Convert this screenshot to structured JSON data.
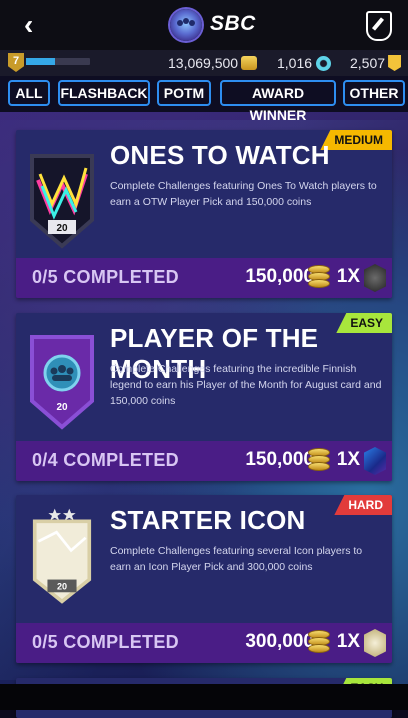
{
  "header": {
    "title": "SBC",
    "back_icon": "back-arrow-icon",
    "tool_icon": "hammer-shield-icon"
  },
  "status": {
    "level": "7",
    "xp_progress": 0.45,
    "coins": "13,069,500",
    "points": "1,016",
    "tokens": "2,507"
  },
  "tabs": [
    "ALL",
    "FLASHBACK",
    "POTM",
    "AWARD WINNER",
    "OTHER"
  ],
  "cards": [
    {
      "title": "ONES TO WATCH",
      "difficulty": "MEDIUM",
      "difficulty_color": "#f5b800",
      "description": "Complete Challenges featuring Ones To Watch players to earn a OTW Player Pick and 150,000 coins",
      "progress": "0/5 COMPLETED",
      "reward": "150,000",
      "pack_count": "1X",
      "badge_text": "20"
    },
    {
      "title": "PLAYER OF THE MONTH",
      "difficulty": "EASY",
      "difficulty_color": "#a8e63c",
      "description": "Complete Challenges featuring the incredible Finnish legend to earn his Player of the Month for August card and 150,000 coins",
      "progress": "0/4 COMPLETED",
      "reward": "150,000",
      "pack_count": "1X",
      "badge_text": "20"
    },
    {
      "title": "STARTER ICON",
      "difficulty": "HARD",
      "difficulty_color": "#e23b3b",
      "description": "Complete Challenges featuring several Icon players to earn an Icon Player Pick and 300,000 coins",
      "progress": "0/5 COMPLETED",
      "reward": "300,000",
      "pack_count": "1X",
      "badge_text": "20"
    }
  ],
  "next_card_difficulty": "EASY"
}
